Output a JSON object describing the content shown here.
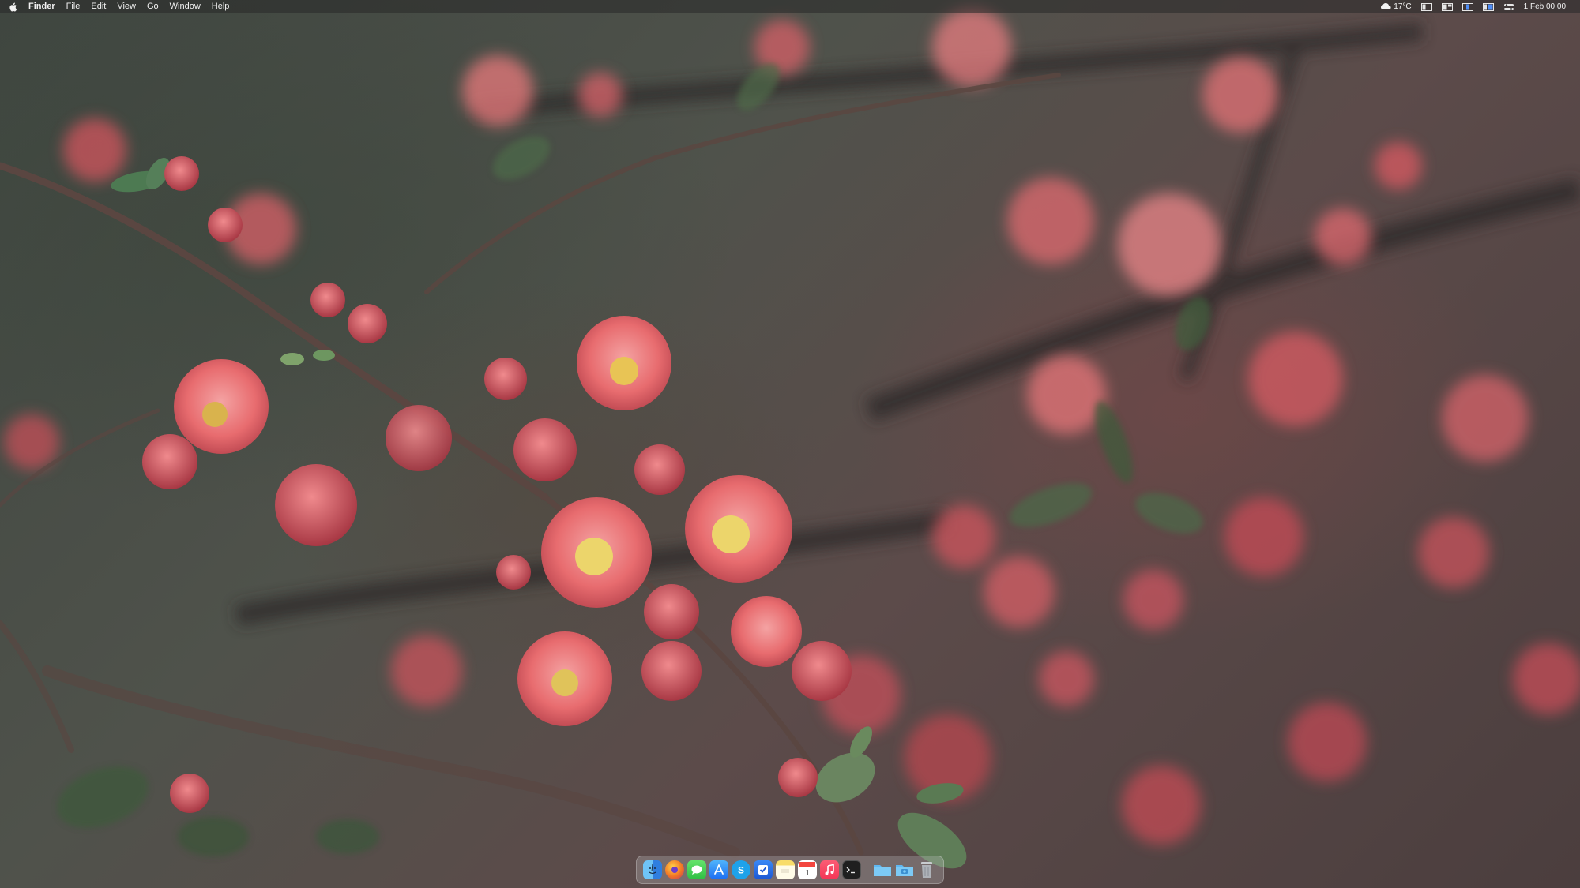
{
  "menubar": {
    "app_name": "Finder",
    "menus": [
      "File",
      "Edit",
      "View",
      "Go",
      "Window",
      "Help"
    ],
    "weather": "17°C",
    "clock": "1 Feb 00:00"
  },
  "dock": {
    "items": [
      {
        "name": "finder",
        "icon": "finder-icon",
        "color": "#3d8fe0"
      },
      {
        "name": "firefox",
        "icon": "firefox-icon",
        "color": "#e66a1f"
      },
      {
        "name": "messages",
        "icon": "messages-icon",
        "color": "#38c750"
      },
      {
        "name": "app-store",
        "icon": "app-store-icon",
        "color": "#2e7cf6"
      },
      {
        "name": "skype",
        "icon": "skype-icon",
        "color": "#1c9ce6"
      },
      {
        "name": "todo",
        "icon": "checkbox-icon",
        "color": "#2a6be0"
      },
      {
        "name": "notes",
        "icon": "notes-icon",
        "color": "#f3d35c"
      },
      {
        "name": "calendar",
        "icon": "calendar-icon",
        "color": "#ffffff"
      },
      {
        "name": "music",
        "icon": "music-icon",
        "color": "#f5415b"
      },
      {
        "name": "terminal",
        "icon": "terminal-icon",
        "color": "#1e1e1e"
      }
    ],
    "stack_items": [
      {
        "name": "folder",
        "icon": "folder-icon",
        "color": "#58b3f0"
      },
      {
        "name": "downloads",
        "icon": "downloads-folder-icon",
        "color": "#58b3f0"
      },
      {
        "name": "trash",
        "icon": "trash-icon",
        "color": "#bfc3c8"
      }
    ]
  }
}
